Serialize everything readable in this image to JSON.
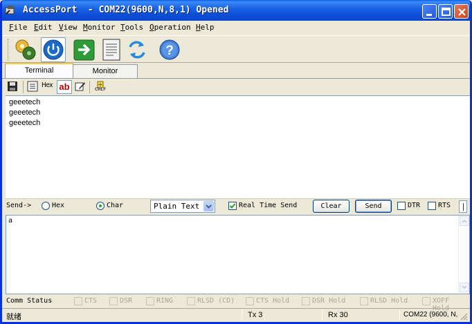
{
  "window": {
    "title": "AccessPort  - COM22(9600,N,8,1) Opened"
  },
  "menu": [
    {
      "label": "File",
      "u": "F",
      "rest": "ile"
    },
    {
      "label": "Edit",
      "u": "E",
      "rest": "dit"
    },
    {
      "label": "View",
      "u": "V",
      "rest": "iew"
    },
    {
      "label": "Monitor",
      "u": "M",
      "rest": "onitor"
    },
    {
      "label": "Tools",
      "u": "T",
      "rest": "ools"
    },
    {
      "label": "Operation",
      "u": "O",
      "rest": "peration"
    },
    {
      "label": "Help",
      "u": "H",
      "rest": "elp"
    }
  ],
  "toolbar": {
    "icons": [
      "settings-gears-icon",
      "power-icon",
      "go-arrow-icon",
      "document-icon",
      "refresh-icon",
      "help-icon"
    ],
    "pressed": "power-icon"
  },
  "tabs": [
    {
      "label": "Terminal",
      "active": true
    },
    {
      "label": "Monitor",
      "active": false
    }
  ],
  "subtoolbar": {
    "hex_label": "Hex",
    "ab_label": "ab",
    "crlf_label": "CRLF"
  },
  "output": {
    "lines": [
      "geeetech",
      "geeetech",
      "geeetech"
    ]
  },
  "send": {
    "label": "Send->",
    "hex_label": "Hex",
    "char_label": "Char",
    "mode_selected": "Char",
    "format_value": "Plain Text",
    "realtime_label": "Real Time Send",
    "realtime_checked": true,
    "clear_label": "Clear",
    "send_label": "Send",
    "dtr_label": "DTR",
    "rts_label": "RTS",
    "input_value": "a"
  },
  "comm_status": {
    "label": "Comm Status",
    "signals": [
      "CTS",
      "DSR",
      "RING",
      "RLSD (CD)",
      "CTS Hold",
      "DSR Hold",
      "RLSD Hold",
      "XOFF Hold"
    ]
  },
  "statusbar": {
    "state": "就绪",
    "tx": "Tx 3",
    "rx": "Rx 30",
    "port": "COM22 (9600, N,"
  },
  "colors": {
    "titlebar": "#0a5ce8",
    "window_bg": "#ece9d8",
    "tab_highlight": "#ffc83c"
  }
}
